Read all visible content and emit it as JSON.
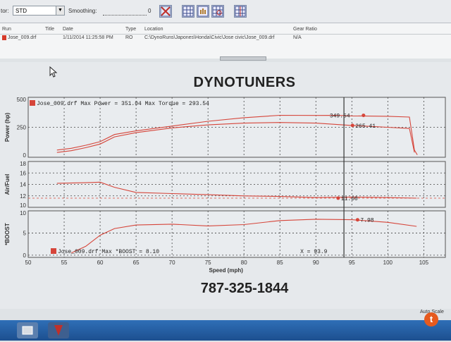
{
  "toolbar": {
    "label_prefix": "tor:",
    "combo_value": "STD",
    "smoothing_label": "Smoothing:",
    "smoothing_value": "0"
  },
  "runs": {
    "headers": [
      "Run",
      "Title",
      "Date",
      "Type",
      "Location",
      "Gear Ratio"
    ],
    "row": {
      "run": "Jose_009.drf",
      "title": "",
      "date": "1/11/2014 11:25:58 PM",
      "type": "RO",
      "location": "C:\\DynoRuns\\Japones\\Honda\\Civic\\Jose civic\\Jose_009.drf",
      "gear_ratio": "N/A"
    }
  },
  "report": {
    "title": "DYNOTUNERS",
    "phone": "787-325-1844"
  },
  "chart_data": {
    "type": "line",
    "xlabel": "Speed (mph)",
    "xlim": [
      50,
      108
    ],
    "x_ticks": [
      "50",
      "55",
      "60",
      "65",
      "70",
      "75",
      "80",
      "85",
      "90",
      "95",
      "100",
      "105"
    ],
    "cursor_x": 93.9,
    "cursor_label": "X = 93.9",
    "panels": [
      {
        "ylabel": "Power (hp)",
        "ylim": [
          0,
          500
        ],
        "y_ticks": [
          "500",
          "250",
          "0"
        ],
        "legend": "Jose_009.drf Max Power = 351.04 Max Torque = 293.54",
        "series": [
          {
            "name": "Power",
            "x": [
              54,
              56,
              58,
              60,
              62,
              65,
              70,
              75,
              80,
              85,
              90,
              93,
              95,
              100,
              103,
              103.7,
              104.1
            ],
            "y": [
              60,
              75,
              100,
              130,
              190,
              220,
              260,
              300,
              330,
              350,
              349,
              349.54,
              345,
              342,
              335,
              60,
              20
            ]
          },
          {
            "name": "Torque",
            "x": [
              54,
              56,
              58,
              60,
              62,
              65,
              70,
              75,
              80,
              85,
              90,
              95,
              100,
              103,
              103.7
            ],
            "y": [
              40,
              55,
              80,
              110,
              170,
              205,
              245,
              270,
              285,
              290,
              285,
              265.41,
              250,
              240,
              40
            ]
          }
        ],
        "labels": [
          {
            "text": "349.54",
            "x": 92.7,
            "y": 349.54
          },
          {
            "text": "265.41",
            "x": 94.7,
            "y": 265.41
          }
        ]
      },
      {
        "ylabel": "Air/Fuel",
        "ylim": [
          10,
          18
        ],
        "y_ticks": [
          "18",
          "16",
          "14",
          "12",
          "10"
        ],
        "legend": "",
        "series": [
          {
            "name": "Air/Fuel",
            "x": [
              54,
              58,
              60,
              62,
              65,
              70,
              75,
              80,
              85,
              90,
              95,
              100,
              104
            ],
            "y": [
              14.2,
              14.3,
              14.4,
              13.5,
              12.6,
              12.4,
              12.2,
              12.0,
              11.9,
              11.7,
              11.8,
              11.7,
              11.6
            ]
          },
          {
            "name": "Reference",
            "x": [
              50,
              108
            ],
            "y": [
              11.6,
              11.6
            ]
          }
        ],
        "labels": [
          {
            "text": "11.60",
            "x": 92.7,
            "y": 11.6
          }
        ]
      },
      {
        "ylabel": "*BOOST",
        "ylim": [
          -0.5,
          10
        ],
        "y_ticks": [
          "10",
          "5",
          "0"
        ],
        "legend": "Jose_009.drf Max *BOOST = 8.10",
        "series": [
          {
            "name": "*BOOST",
            "x": [
              56,
              58,
              60,
              62,
              65,
              70,
              75,
              80,
              85,
              90,
              95,
              100,
              104
            ],
            "y": [
              0.5,
              2,
              4.5,
              6.0,
              6.8,
              7.0,
              6.6,
              6.9,
              7.8,
              8.1,
              8.0,
              7.4,
              6.5
            ]
          }
        ],
        "labels": [
          {
            "text": "7.98",
            "x": 95.4,
            "y": 7.98
          }
        ]
      }
    ]
  }
}
